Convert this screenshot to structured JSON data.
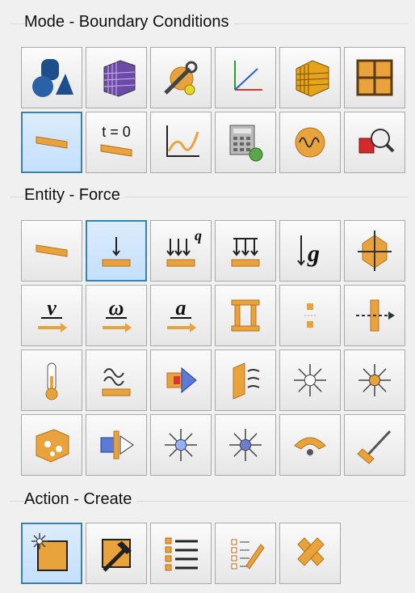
{
  "mode": {
    "title": "Mode - Boundary Conditions",
    "buttons": [
      {
        "icon": "geometry-icon",
        "selected": false
      },
      {
        "icon": "mesh-icon",
        "selected": false
      },
      {
        "icon": "tools-icon",
        "selected": false
      },
      {
        "icon": "coordinate-system-icon",
        "selected": false
      },
      {
        "icon": "mesh-elements-icon",
        "selected": false
      },
      {
        "icon": "nodes-grid-icon",
        "selected": false
      },
      {
        "icon": "boundary-conditions-icon",
        "selected": true
      },
      {
        "icon": "initial-conditions-icon",
        "selected": false,
        "label": "t = 0"
      },
      {
        "icon": "time-curve-icon",
        "selected": false
      },
      {
        "icon": "calculator-settings-icon",
        "selected": false
      },
      {
        "icon": "wave-icon",
        "selected": false
      },
      {
        "icon": "inspect-icon",
        "selected": false
      }
    ]
  },
  "entity": {
    "title": "Entity - Force",
    "buttons": [
      {
        "icon": "plate-load-icon",
        "selected": false
      },
      {
        "icon": "force-icon",
        "selected": true
      },
      {
        "icon": "distributed-load-icon",
        "selected": false,
        "label": "q"
      },
      {
        "icon": "pressure-icon",
        "selected": false
      },
      {
        "icon": "gravity-icon",
        "selected": false,
        "label": "g"
      },
      {
        "icon": "constraint-icon",
        "selected": false
      },
      {
        "icon": "velocity-icon",
        "selected": false,
        "label": "v"
      },
      {
        "icon": "angular-velocity-icon",
        "selected": false,
        "label": "ω"
      },
      {
        "icon": "acceleration-icon",
        "selected": false,
        "label": "a"
      },
      {
        "icon": "rigid-wall-icon",
        "selected": false
      },
      {
        "icon": "contact-gap-icon",
        "selected": false
      },
      {
        "icon": "bolt-preload-icon",
        "selected": false
      },
      {
        "icon": "temperature-icon",
        "selected": false
      },
      {
        "icon": "heat-convection-icon",
        "selected": false
      },
      {
        "icon": "heat-flux-icon",
        "selected": false
      },
      {
        "icon": "radiation-icon",
        "selected": false
      },
      {
        "icon": "point-heat-icon",
        "selected": false
      },
      {
        "icon": "body-heat-icon",
        "selected": false
      },
      {
        "icon": "volume-source-icon",
        "selected": false
      },
      {
        "icon": "surface-flux-icon",
        "selected": false
      },
      {
        "icon": "point-source-icon",
        "selected": false
      },
      {
        "icon": "sphere-source-icon",
        "selected": false
      },
      {
        "icon": "emitter-icon",
        "selected": false
      },
      {
        "icon": "weld-icon",
        "selected": false
      }
    ]
  },
  "action": {
    "title": "Action - Create",
    "buttons": [
      {
        "icon": "create-icon",
        "selected": true
      },
      {
        "icon": "modify-icon",
        "selected": false
      },
      {
        "icon": "list-icon",
        "selected": false
      },
      {
        "icon": "edit-list-icon",
        "selected": false
      },
      {
        "icon": "delete-icon",
        "selected": false
      }
    ]
  },
  "colors": {
    "selected_border": "#3c7fb1",
    "selected_bg": "#cfe6fb",
    "tile_border": "#a9a9a9",
    "accent_orange": "#e8a33d"
  }
}
